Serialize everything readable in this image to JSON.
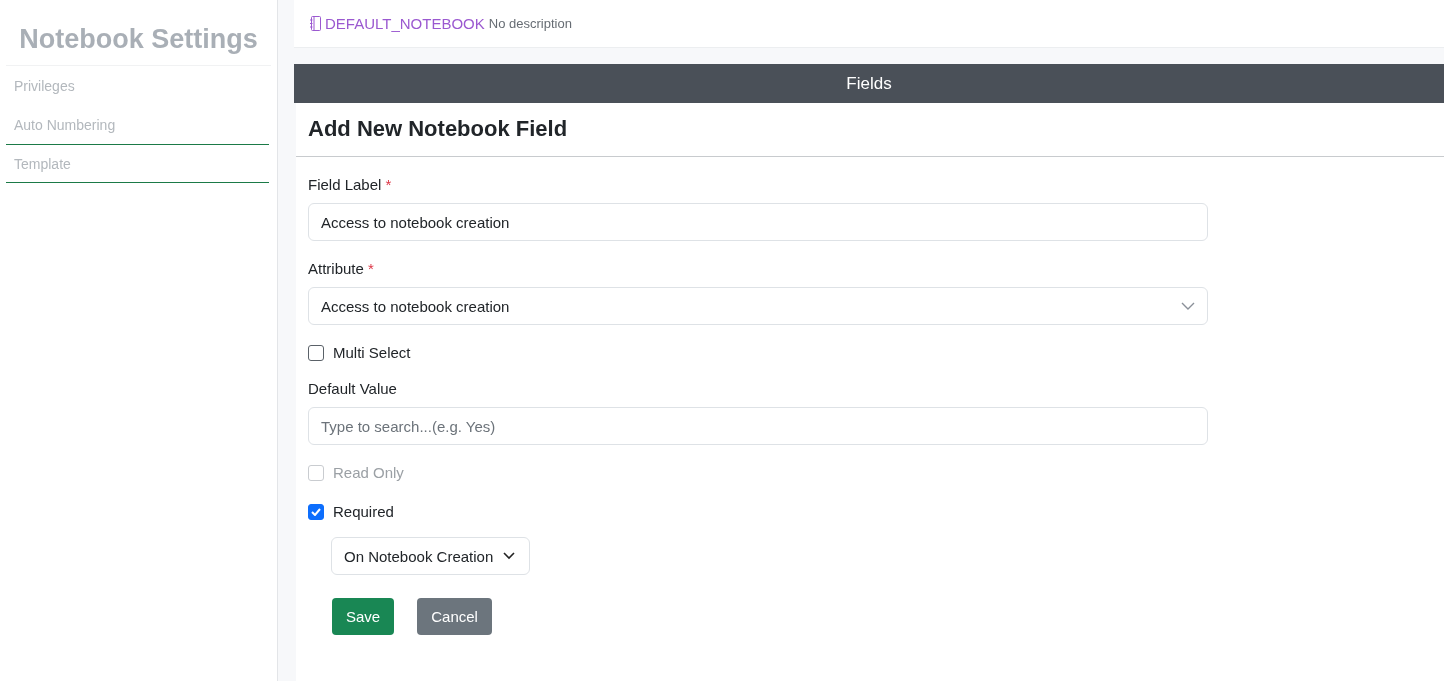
{
  "sidebar": {
    "title": "Notebook Settings",
    "items": [
      {
        "label": "Privileges",
        "selected": false
      },
      {
        "label": "Auto Numbering",
        "selected": false
      },
      {
        "label": "Template",
        "selected": true
      }
    ]
  },
  "header": {
    "notebook": "DEFAULT_NOTEBOOK",
    "description": "No description"
  },
  "section_bar": {
    "title": "Fields"
  },
  "form": {
    "title": "Add New Notebook Field",
    "field_label": {
      "label": "Field Label",
      "required_mark": "*",
      "value": "Access to notebook creation"
    },
    "attribute": {
      "label": "Attribute",
      "required_mark": "*",
      "value": "Access to notebook creation"
    },
    "multi_select": {
      "label": "Multi Select",
      "checked": false
    },
    "default_value": {
      "label": "Default Value",
      "placeholder": "Type to search...(e.g. Yes)"
    },
    "read_only": {
      "label": "Read Only",
      "checked": false,
      "disabled": true
    },
    "required": {
      "label": "Required",
      "checked": true
    },
    "required_when": {
      "value": "On Notebook Creation"
    },
    "buttons": [
      {
        "label": "Save",
        "kind": "primary"
      },
      {
        "label": "Cancel",
        "kind": "secondary"
      }
    ]
  }
}
